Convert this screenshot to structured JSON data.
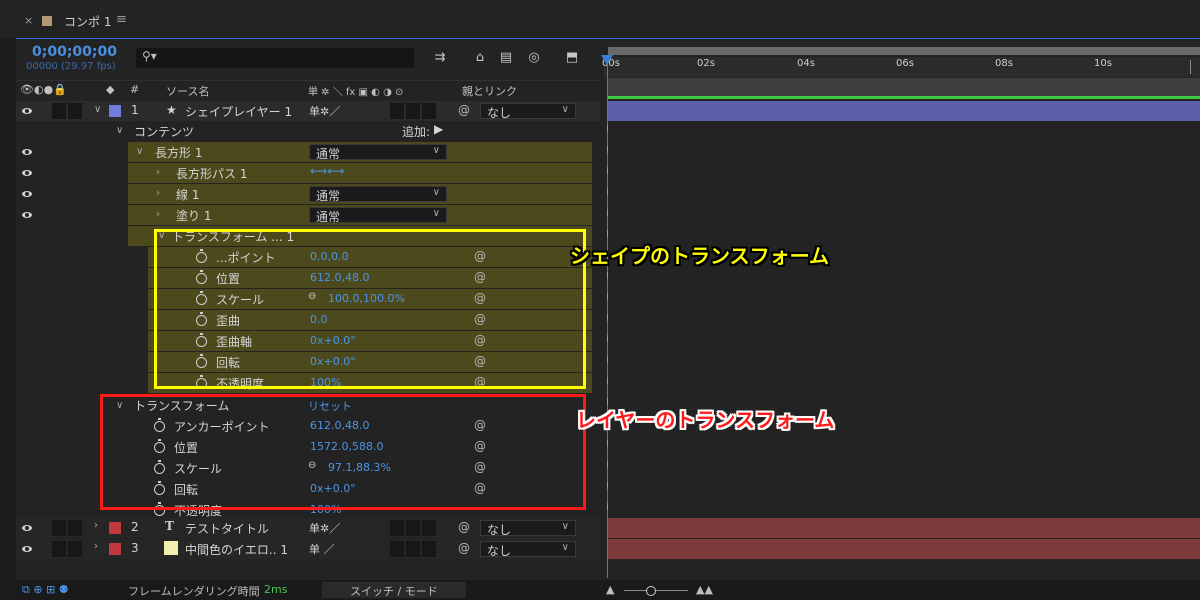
{
  "tab": {
    "label": "コンポ 1"
  },
  "header": {
    "timecode": "0;00;00;00",
    "fps": "00000 (29.97 fps)"
  },
  "columns": {
    "source_name": "ソース名",
    "switches": "単 ✲ ＼ fx ▣ ◐ ◑ ⊙",
    "parent": "親とリンク",
    "num": "#"
  },
  "layers": [
    {
      "num": "1",
      "name": "シェイプレイヤー 1",
      "color": "#6f7fd9",
      "parent": "なし",
      "type_icon": "★"
    },
    {
      "num": "2",
      "name": "テストタイトル",
      "color": "#c0393f",
      "parent": "なし",
      "type_icon": "T"
    },
    {
      "num": "3",
      "name": "中間色のイエロ.. 1",
      "color": "#c0393f",
      "parent": "なし",
      "type_icon": "▢"
    }
  ],
  "contents": {
    "label": "コンテンツ",
    "add_label": "追加:"
  },
  "rect": {
    "name": "長方形 1",
    "mode": "通常",
    "path": "長方形パス 1",
    "stroke": "線 1",
    "stroke_mode": "通常",
    "fill": "塗り 1",
    "fill_mode": "通常",
    "transform_label": "トランスフォーム ... 1"
  },
  "shape_props": [
    {
      "label": "...ポイント",
      "value": "0.0,0.0"
    },
    {
      "label": "位置",
      "value": "612.0,48.0"
    },
    {
      "label": "スケール",
      "value": "100.0,100.0%"
    },
    {
      "label": "歪曲",
      "value": "0.0"
    },
    {
      "label": "歪曲軸",
      "value": "0x+0.0°"
    },
    {
      "label": "回転",
      "value": "0x+0.0°"
    },
    {
      "label": "不透明度",
      "value": "100%"
    }
  ],
  "layer_transform": {
    "label": "トランスフォーム",
    "reset": "リセット"
  },
  "layer_props": [
    {
      "label": "アンカーポイント",
      "value": "612.0,48.0"
    },
    {
      "label": "位置",
      "value": "1572.0,588.0"
    },
    {
      "label": "スケール",
      "value": "97.1,88.3%"
    },
    {
      "label": "回転",
      "value": "0x+0.0°"
    },
    {
      "label": "不透明度",
      "value": "100%"
    }
  ],
  "callouts": {
    "shape": "シェイプのトランスフォーム",
    "layer": "レイヤーのトランスフォーム"
  },
  "ruler": {
    "ticks": [
      "00s",
      "02s",
      "04s",
      "06s",
      "08s",
      "10s"
    ]
  },
  "footer": {
    "render_label": "フレームレンダリング時間",
    "render_time": "2ms",
    "toggle": "スイッチ / モード"
  },
  "colors": {
    "accent": "#2d6fd6",
    "yellow_box": "#ffff00",
    "red_box": "#ff1a1a",
    "track_layer": "#5c60a8",
    "track_red": "#7d3a3d"
  }
}
